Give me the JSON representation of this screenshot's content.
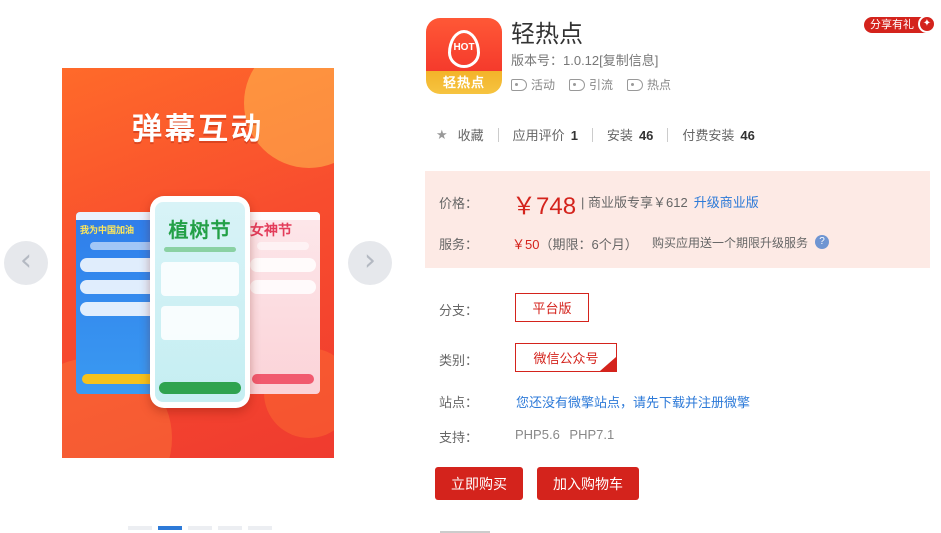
{
  "gallery": {
    "slide_title": "弹幕互动",
    "phone_title": "植树节",
    "pink_card_title": "女神节",
    "blue_card_text": "我为中国加油",
    "prev_arrow": "‹",
    "next_arrow": "›",
    "active_dot": 1,
    "dot_count": 5
  },
  "app": {
    "icon_badge": "HOT",
    "icon_name": "轻热点",
    "title": "轻热点",
    "version_label": "版本号：1.0.12",
    "copy_info": "[复制信息]",
    "tags": [
      "活动",
      "引流",
      "热点"
    ],
    "share_label": "分享有礼"
  },
  "stats": {
    "favorite_label": "收藏",
    "rating_label": "应用评价",
    "rating_value": "1",
    "install_label": "安装",
    "install_value": "46",
    "paid_install_label": "付费安装",
    "paid_install_value": "46"
  },
  "pricing": {
    "price_label": "价格：",
    "price_value": "￥748",
    "pro_text": "| 商业版专享￥612",
    "upgrade_link": "升级商业版",
    "service_label": "服务：",
    "service_price": "￥50",
    "service_period": "（期限：6个月）",
    "service_desc": "购买应用送一个期限升级服务",
    "help_icon": "?"
  },
  "options": {
    "branch_label": "分支：",
    "branch_value": "平台版",
    "category_label": "类别：",
    "category_value": "微信公众号",
    "site_label": "站点：",
    "site_text": "您还没有微擎站点，请先下载并注册微擎",
    "support_label": "支持：",
    "support_text": "PHP5.6 PHP7.1"
  },
  "actions": {
    "buy_label": "立即购买",
    "cart_label": "加入购物车"
  },
  "colors": {
    "brand_red": "#d4231c",
    "link_blue": "#2d7ad8",
    "price_bg": "#fdeae5"
  }
}
